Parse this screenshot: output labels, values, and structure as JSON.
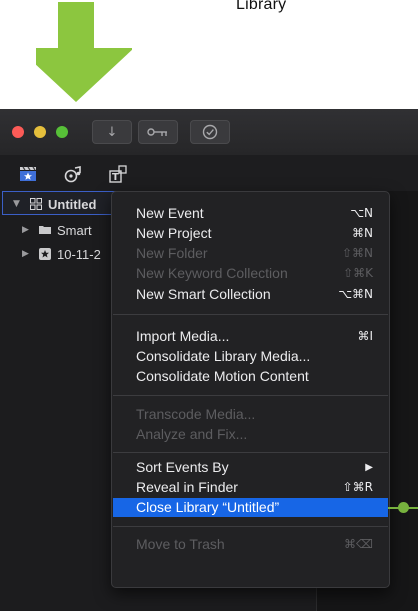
{
  "annotation": {
    "label": "Library",
    "accent_color": "#8cc63f"
  },
  "toolbar": {
    "traffic_lights": [
      "#fc5b57",
      "#e5bf3c",
      "#57c038"
    ],
    "import_icon": "down-arrow-icon",
    "keyword_icon": "key-icon",
    "background_tasks_icon": "checkmark-circle-icon",
    "import_glyph": "↓",
    "keyword_glyph": "o─π",
    "tasks_glyph": "⊘"
  },
  "browser_bar": {
    "icons": [
      "libraries-clapper-star-icon",
      "photos-audio-icon",
      "titles-generators-icon"
    ]
  },
  "sidebar": {
    "library": {
      "name": "Untitled",
      "icon": "library-grid-icon",
      "expanded": true
    },
    "items": [
      {
        "name": "Smart",
        "icon": "folder-icon"
      },
      {
        "name": "10-11-2",
        "icon": "star-event-icon"
      }
    ]
  },
  "context_menu": {
    "groups": [
      [
        {
          "label": "New Event",
          "shortcut": "⌥N",
          "enabled": true
        },
        {
          "label": "New Project",
          "shortcut": "⌘N",
          "enabled": true
        },
        {
          "label": "New Folder",
          "shortcut": "⇧⌘N",
          "enabled": false
        },
        {
          "label": "New Keyword Collection",
          "shortcut": "⇧⌘K",
          "enabled": false
        },
        {
          "label": "New Smart Collection",
          "shortcut": "⌥⌘N",
          "enabled": true
        }
      ],
      [
        {
          "label": "Import Media...",
          "shortcut": "⌘I",
          "enabled": true
        },
        {
          "label": "Consolidate Library Media...",
          "shortcut": "",
          "enabled": true
        },
        {
          "label": "Consolidate Motion Content",
          "shortcut": "",
          "enabled": true
        }
      ],
      [
        {
          "label": "Transcode Media...",
          "shortcut": "",
          "enabled": false
        },
        {
          "label": "Analyze and Fix...",
          "shortcut": "",
          "enabled": false
        }
      ],
      [
        {
          "label": "Sort Events By",
          "shortcut": "▶",
          "enabled": true
        },
        {
          "label": "Reveal in Finder",
          "shortcut": "⇧⌘R",
          "enabled": true
        },
        {
          "label": "Close Library “Untitled”",
          "shortcut": "",
          "enabled": true,
          "highlighted": true
        }
      ],
      [
        {
          "label": "Move to Trash",
          "shortcut": "⌘⌫",
          "enabled": false
        }
      ]
    ]
  }
}
